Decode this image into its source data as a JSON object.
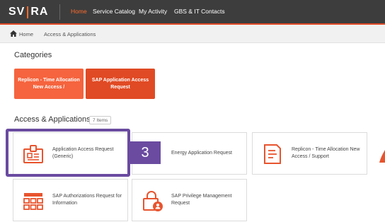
{
  "header": {
    "logo_left": "SV",
    "logo_right": "RA",
    "nav": [
      {
        "label": "Home",
        "active": true
      },
      {
        "label": "Service Catalog",
        "active": false
      },
      {
        "label": "My Activity",
        "active": false
      },
      {
        "label": "GBS & IT Contacts",
        "active": false
      }
    ]
  },
  "breadcrumb": {
    "items": [
      "Home",
      "Access & Applications"
    ],
    "home_icon": "home-icon"
  },
  "categories": {
    "heading": "Categories",
    "tiles": [
      {
        "label": "Replicon - Time Allocation New Access /"
      },
      {
        "label": "SAP Application Access Request"
      }
    ]
  },
  "access": {
    "heading": "Access & Applications",
    "count": "7 Items",
    "cards": [
      {
        "label": "Application Access Request (Generic)",
        "icon": "id-card-icon"
      },
      {
        "label": "Energy Application Request",
        "icon": "lightning-icon"
      },
      {
        "label": "Replicon - Time Allocation New Access / Support",
        "icon": "document-icon"
      },
      {
        "label": "SAP Authorizations Request for Information",
        "icon": "calendar-grid-icon"
      },
      {
        "label": "SAP Privilege Management Request",
        "icon": "lock-user-icon"
      }
    ]
  },
  "annotation": {
    "step": "3"
  },
  "colors": {
    "accent": "#e34a26",
    "nav_bg": "#3d3d3d",
    "highlight": "#6a4ba0"
  }
}
